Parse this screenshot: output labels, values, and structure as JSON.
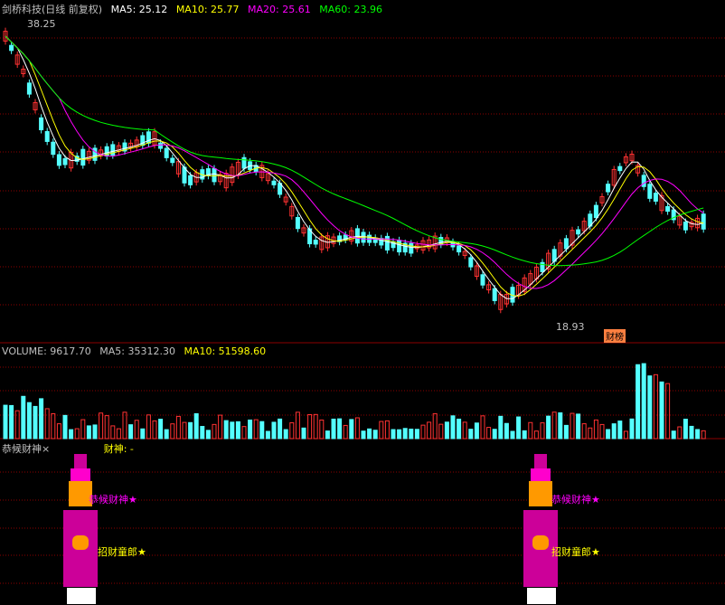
{
  "main_legend": {
    "title": "剑桥科技(日线 前复权)",
    "ma5_label": "MA5: 25.12",
    "ma10_label": "MA10: 25.77",
    "ma20_label": "MA20: 25.61",
    "ma60_label": "MA60: 23.96",
    "title_color": "#c0c0c0",
    "ma5_color": "#ffffff",
    "ma10_color": "#ffff00",
    "ma20_color": "#ff00ff",
    "ma60_color": "#00ff00"
  },
  "high_marker": "38.25",
  "low_marker": "18.93",
  "badge_text": "财榜",
  "volume_legend": {
    "volume_label": "VOLUME: 9617.70",
    "ma5_label": "MA5: 35312.30",
    "ma10_label": "MA10: 51598.60"
  },
  "indicator": {
    "name": "恭候财神",
    "close_mark": "×",
    "field_label": "财神: -",
    "left_figure": {
      "text_top": "恭候财神★",
      "text_bottom": "招财童郎★"
    },
    "right_figure": {
      "text_top": "恭候财神★",
      "text_bottom": "招财童郎★"
    }
  },
  "colors": {
    "up": "#ff3232",
    "down": "#54ffff",
    "grid": "#8b0000",
    "magenta": "#ff00ff",
    "yellow": "#ffff00"
  }
}
